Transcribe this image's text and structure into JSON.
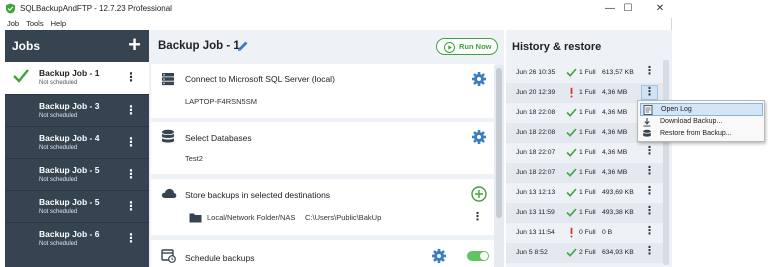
{
  "window": {
    "title": "SQLBackupAndFTP - 12.7.23 Professional",
    "controls": {
      "minimize": "—",
      "maximize": "☐",
      "close": "✕"
    }
  },
  "menu": [
    "Job",
    "Tools",
    "Help"
  ],
  "jobs_panel": {
    "title": "Jobs",
    "add_label": "+",
    "items": [
      {
        "name": "Backup Job - 1",
        "status": "Not scheduled",
        "active": true
      },
      {
        "name": "Backup Job - 3",
        "status": "Not scheduled",
        "active": false
      },
      {
        "name": "Backup Job - 4",
        "status": "Not scheduled",
        "active": false
      },
      {
        "name": "Backup Job - 5",
        "status": "Not scheduled",
        "active": false
      },
      {
        "name": "Backup Job - 5",
        "status": "Not scheduled",
        "active": false
      },
      {
        "name": "Backup Job - 6",
        "status": "Not scheduled",
        "active": false
      }
    ]
  },
  "main": {
    "title": "Backup Job - 1",
    "run_label": "Run Now",
    "sections": {
      "connect": {
        "title": "Connect to Microsoft SQL Server (local)",
        "value": "LAPTOP-F4RSN5SM"
      },
      "databases": {
        "title": "Select Databases",
        "value": "Test2"
      },
      "destinations": {
        "title": "Store backups in selected destinations",
        "dest_type": "Local/Network Folder/NAS",
        "dest_path": "C:\\Users\\Public\\BakUp"
      },
      "schedule": {
        "title": "Schedule backups",
        "enabled": true
      }
    }
  },
  "history": {
    "title": "History & restore",
    "rows": [
      {
        "date": "Jun 26 10:35",
        "status": "success",
        "type": "1 Full",
        "size": "613,57 KB"
      },
      {
        "date": "Jun 20 12:39",
        "status": "warning",
        "type": "1 Full",
        "size": "4,36 MB"
      },
      {
        "date": "Jun 18 22:08",
        "status": "success",
        "type": "1 Full",
        "size": "4,36 MB"
      },
      {
        "date": "Jun 18 22:08",
        "status": "success",
        "type": "1 Full",
        "size": "4,36 MB"
      },
      {
        "date": "Jun 18 22:07",
        "status": "success",
        "type": "1 Full",
        "size": "4,36 MB"
      },
      {
        "date": "Jun 18 22:07",
        "status": "success",
        "type": "1 Full",
        "size": "4,36 MB"
      },
      {
        "date": "Jun 13 12:13",
        "status": "success",
        "type": "1 Full",
        "size": "493,69 KB"
      },
      {
        "date": "Jun 13 11:59",
        "status": "success",
        "type": "1 Full",
        "size": "493,38 KB"
      },
      {
        "date": "Jun 13 11:54",
        "status": "warning",
        "type": "0 Full",
        "size": "0 B"
      },
      {
        "date": "Jun 5 8:52",
        "status": "success",
        "type": "2 Full",
        "size": "634,93 KB"
      }
    ]
  },
  "context_menu": {
    "items": [
      {
        "label": "Open Log",
        "icon": "log-icon"
      },
      {
        "label": "Download Backup...",
        "icon": "download-icon"
      },
      {
        "label": "Restore from Backup...",
        "icon": "restore-icon"
      }
    ]
  },
  "colors": {
    "sidebar": "#364451",
    "accent_green": "#3fa33f",
    "gear_blue": "#3b7dc4",
    "warning_red": "#d9342b"
  }
}
